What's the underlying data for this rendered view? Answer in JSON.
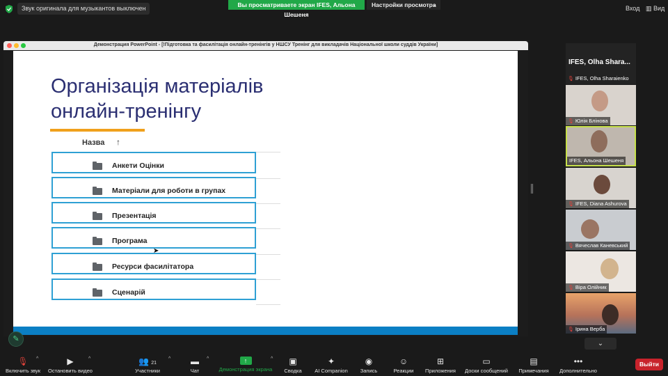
{
  "topbar": {
    "music_notice": "Звук оригинала для музыкантов выключен",
    "share_banner": "Вы просматриваете экран IFES, Альона Шешеня",
    "view_settings": "Настройки просмотра",
    "exit": "Вход",
    "view": "Вид"
  },
  "window": {
    "title": "Демонстрация PowerPoint - [!Підготовка та фасилітація онлайн-тренінгів у НШСУ Тренінг для викладачів Національної школи суддів України]"
  },
  "slide": {
    "title_line1": "Організація матеріалів",
    "title_line2": "онлайн-тренінгу",
    "column_header": "Назва",
    "sort_icon": "↑",
    "rows": [
      "Анкети Оцінки",
      "Матеріали для роботи в групах",
      "Презентація",
      "Програма",
      "Ресурси фасилітатора",
      "Сценарій"
    ]
  },
  "participants": {
    "header": "IFES, Olha Shara...",
    "tiles": [
      "IFES, Olha Sharaienko",
      "Юлія Блінова",
      "IFES, Альона Шешеня",
      "IFES, Diana Ashurova",
      "Вячеслав Каневський",
      "Віра Олійник",
      "Ірина Верба"
    ]
  },
  "toolbar": {
    "mute": "Включить звук",
    "video": "Остановить видео",
    "participants": "Участники",
    "participants_count": "21",
    "chat": "Чат",
    "share": "Демонстрация экрана",
    "summary": "Сводка",
    "ai": "AI Companion",
    "record": "Запись",
    "reactions": "Реакции",
    "apps": "Приложения",
    "whiteboards": "Доски сообщений",
    "notes": "Примечания",
    "more": "Дополнительно",
    "leave": "Выйти"
  }
}
